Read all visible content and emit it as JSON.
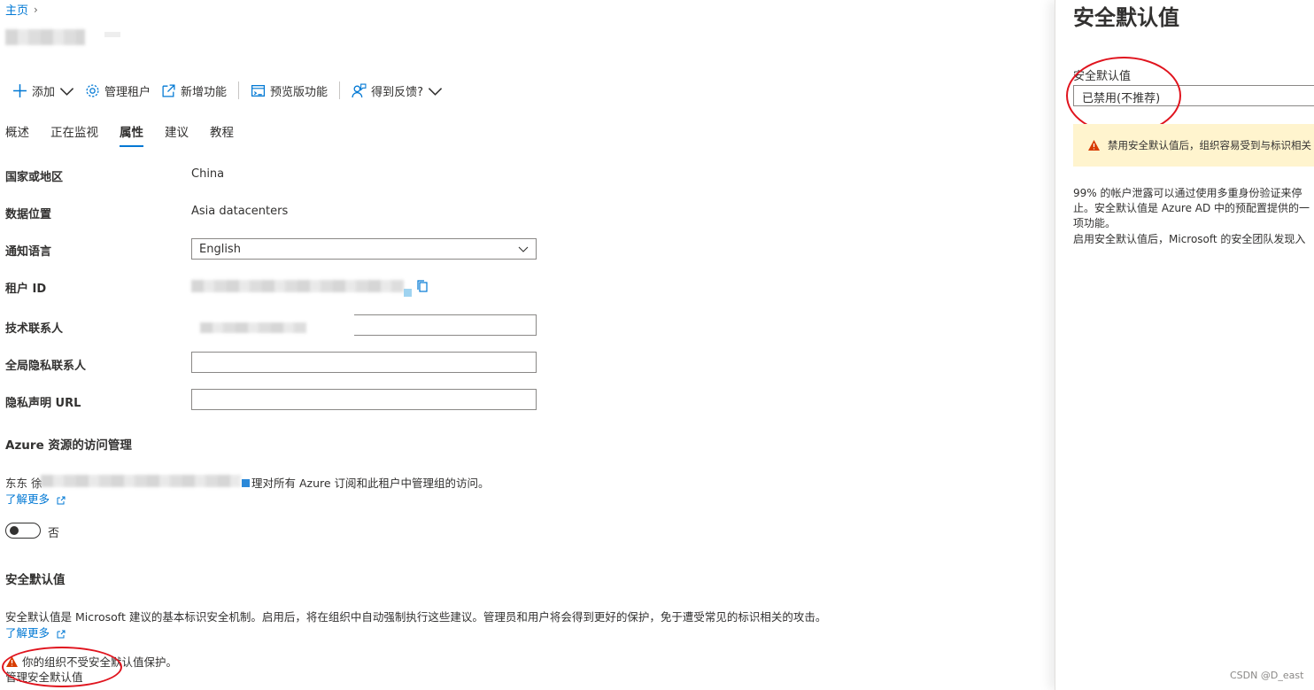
{
  "breadcrumb": {
    "home": "主页"
  },
  "toolbar": {
    "add": "添加",
    "manage_tenant": "管理租户",
    "new_feature": "新增功能",
    "preview_features": "预览版功能",
    "feedback": "得到反馈?"
  },
  "tabs": [
    "概述",
    "正在监视",
    "属性",
    "建议",
    "教程"
  ],
  "active_tab": "属性",
  "properties": {
    "country_label": "国家或地区",
    "country_value": "China",
    "data_location_label": "数据位置",
    "data_location_value": "Asia datacenters",
    "notify_lang_label": "通知语言",
    "notify_lang_value": "English",
    "tenant_id_label": "租户 ID",
    "tech_contact_label": "技术联系人",
    "global_privacy_label": "全局隐私联系人",
    "privacy_url_label": "隐私声明 URL"
  },
  "azure_access": {
    "title": "Azure 资源的访问管理",
    "text_prefix": "东东 徐",
    "text_suffix": "理对所有 Azure 订阅和此租户中管理组的访问。",
    "learn_more": "了解更多",
    "toggle_label": "否"
  },
  "security_defaults": {
    "title": "安全默认值",
    "description": "安全默认值是 Microsoft 建议的基本标识安全机制。启用后，将在组织中自动强制执行这些建议。管理员和用户将会得到更好的保护，免于遭受常见的标识相关的攻击。",
    "learn_more": "了解更多",
    "warning": "你的组织不受安全默认值保护。",
    "manage_link": "管理安全默认值"
  },
  "panel": {
    "title": "安全默认值",
    "field_label": "安全默认值",
    "field_value": "已禁用(不推荐)",
    "warning": "禁用安全默认值后，组织容易受到与标识相关",
    "text1": "99% 的帐户泄露可以通过使用多重身份验证来停止。安全默认值是 Azure AD 中的预配置提供的一项功能。",
    "text2": "启用安全默认值后，Microsoft 的安全团队发现入"
  },
  "watermark": "CSDN @D_east",
  "colors": {
    "accent": "#0078d4",
    "warning_bg": "#fff4ce",
    "warning_icon": "#d83b01",
    "annotation": "#e0141e"
  }
}
